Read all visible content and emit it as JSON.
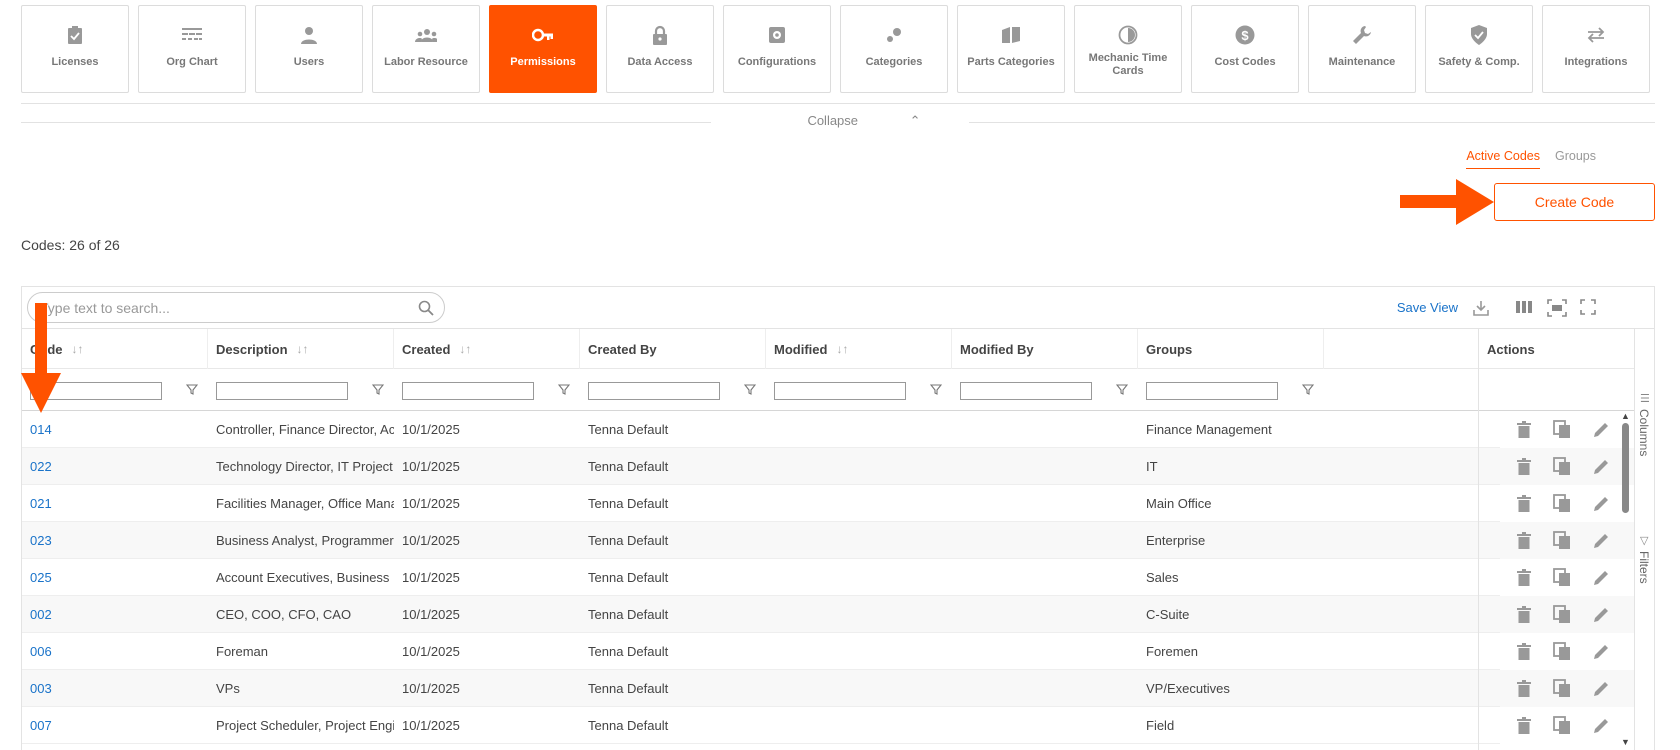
{
  "tiles": [
    {
      "label": "Licenses",
      "icon": "clipboard-check-icon"
    },
    {
      "label": "Org Chart",
      "icon": "org-chart-icon"
    },
    {
      "label": "Users",
      "icon": "user-icon"
    },
    {
      "label": "Labor Resource",
      "icon": "people-group-icon"
    },
    {
      "label": "Permissions",
      "icon": "key-icon",
      "active": true
    },
    {
      "label": "Data Access",
      "icon": "lock-icon"
    },
    {
      "label": "Configurations",
      "icon": "gear-box-icon"
    },
    {
      "label": "Categories",
      "icon": "dots-icon"
    },
    {
      "label": "Parts Categories",
      "icon": "book-icon"
    },
    {
      "label": "Mechanic Time Cards",
      "icon": "clock-icon"
    },
    {
      "label": "Cost Codes",
      "icon": "dollar-circle-icon"
    },
    {
      "label": "Maintenance",
      "icon": "wrench-icon"
    },
    {
      "label": "Safety & Comp.",
      "icon": "shield-check-icon"
    },
    {
      "label": "Integrations",
      "icon": "swap-arrows-icon"
    }
  ],
  "collapse_label": "Collapse",
  "view_tabs": {
    "active": "Active Codes",
    "other": "Groups"
  },
  "create_button": "Create Code",
  "codes_count": "Codes: 26 of 26",
  "search_placeholder": "Type text to search...",
  "save_view": "Save View",
  "columns": {
    "code": "Code",
    "description": "Description",
    "created": "Created",
    "created_by": "Created By",
    "modified": "Modified",
    "modified_by": "Modified By",
    "groups": "Groups",
    "actions": "Actions"
  },
  "side_panel": {
    "columns": "Columns",
    "filters": "Filters"
  },
  "accent_color": "#ff5200",
  "link_color": "#1a73c9",
  "rows": [
    {
      "code": "014",
      "description": "Controller, Finance Director, Acc",
      "created": "10/1/2025",
      "created_by": "Tenna Default",
      "modified": "",
      "modified_by": "",
      "groups": "Finance Management"
    },
    {
      "code": "022",
      "description": "Technology Director, IT Project",
      "created": "10/1/2025",
      "created_by": "Tenna Default",
      "modified": "",
      "modified_by": "",
      "groups": "IT"
    },
    {
      "code": "021",
      "description": "Facilities Manager, Office Mana",
      "created": "10/1/2025",
      "created_by": "Tenna Default",
      "modified": "",
      "modified_by": "",
      "groups": "Main Office"
    },
    {
      "code": "023",
      "description": "Business Analyst, Programmer",
      "created": "10/1/2025",
      "created_by": "Tenna Default",
      "modified": "",
      "modified_by": "",
      "groups": "Enterprise"
    },
    {
      "code": "025",
      "description": "Account Executives, Business I",
      "created": "10/1/2025",
      "created_by": "Tenna Default",
      "modified": "",
      "modified_by": "",
      "groups": "Sales"
    },
    {
      "code": "002",
      "description": "CEO, COO, CFO, CAO",
      "created": "10/1/2025",
      "created_by": "Tenna Default",
      "modified": "",
      "modified_by": "",
      "groups": "C-Suite"
    },
    {
      "code": "006",
      "description": "Foreman",
      "created": "10/1/2025",
      "created_by": "Tenna Default",
      "modified": "",
      "modified_by": "",
      "groups": "Foremen"
    },
    {
      "code": "003",
      "description": "VPs",
      "created": "10/1/2025",
      "created_by": "Tenna Default",
      "modified": "",
      "modified_by": "",
      "groups": "VP/Executives"
    },
    {
      "code": "007",
      "description": "Project Scheduler, Project Engi",
      "created": "10/1/2025",
      "created_by": "Tenna Default",
      "modified": "",
      "modified_by": "",
      "groups": "Field"
    }
  ]
}
